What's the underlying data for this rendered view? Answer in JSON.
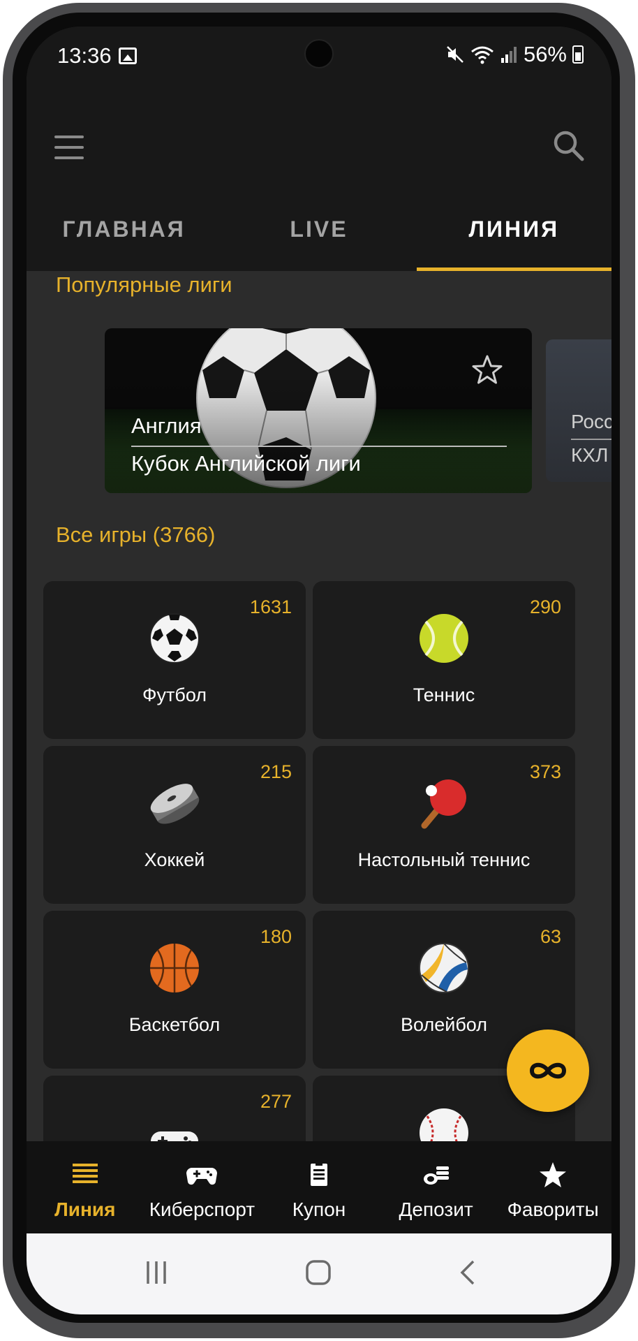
{
  "status_bar": {
    "time": "13:36",
    "battery": "56%"
  },
  "header": {
    "tabs": [
      {
        "label": "ГЛАВНАЯ",
        "active": false
      },
      {
        "label": "LIVE",
        "active": false
      },
      {
        "label": "ЛИНИЯ",
        "active": true
      }
    ]
  },
  "popular": {
    "title": "Популярные лиги",
    "leagues": [
      {
        "country": "Англия",
        "name": "Кубок Английской лиги",
        "icon": "star-outline-icon"
      },
      {
        "country": "Росс",
        "name": "КХЛ"
      }
    ]
  },
  "all_games": {
    "title": "Все игры (3766)",
    "sports": [
      {
        "name": "Футбол",
        "count": "1631",
        "icon": "soccer-ball-icon"
      },
      {
        "name": "Теннис",
        "count": "290",
        "icon": "tennis-ball-icon"
      },
      {
        "name": "Хоккей",
        "count": "215",
        "icon": "hockey-puck-icon"
      },
      {
        "name": "Настольный теннис",
        "count": "373",
        "icon": "ping-pong-icon"
      },
      {
        "name": "Баскетбол",
        "count": "180",
        "icon": "basketball-icon"
      },
      {
        "name": "Волейбол",
        "count": "63",
        "icon": "volleyball-icon"
      },
      {
        "name": "",
        "count": "277",
        "icon": "gamepad-icon"
      },
      {
        "name": "",
        "count": "",
        "icon": "baseball-icon"
      }
    ]
  },
  "bottom_nav": {
    "items": [
      {
        "label": "Линия",
        "icon": "list-icon",
        "active": true
      },
      {
        "label": "Киберспорт",
        "icon": "gamepad-icon",
        "active": false
      },
      {
        "label": "Купон",
        "icon": "coupon-icon",
        "active": false
      },
      {
        "label": "Депозит",
        "icon": "coins-icon",
        "active": false
      },
      {
        "label": "Фавориты",
        "icon": "star-icon",
        "active": false
      }
    ]
  },
  "colors": {
    "accent": "#e7b22b",
    "background": "#2c2c2c",
    "card": "#1c1c1c",
    "header": "#181818"
  }
}
